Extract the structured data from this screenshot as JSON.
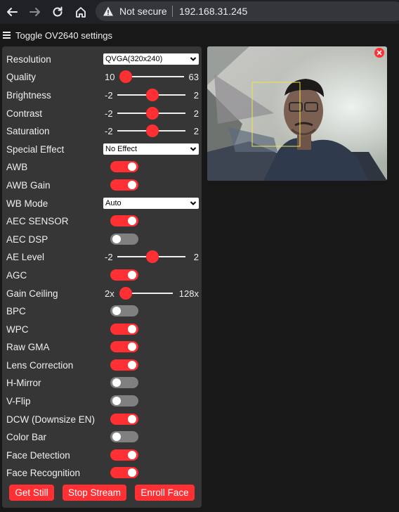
{
  "browser": {
    "security_text": "Not secure",
    "url": "192.168.31.245",
    "icons": [
      "back-arrow-icon",
      "forward-arrow-icon",
      "reload-icon",
      "home-icon",
      "warning-icon"
    ]
  },
  "header": {
    "toggle_label": "Toggle OV2640 settings",
    "icon": "hamburger-icon"
  },
  "colors": {
    "accent": "#ff3034",
    "panel_bg": "#363636",
    "page_bg": "#181818",
    "toggle_off": "#808080",
    "face_box": "#f0e54a"
  },
  "settings": {
    "resolution": {
      "label": "Resolution",
      "value": "QVGA(320x240)"
    },
    "quality": {
      "label": "Quality",
      "min": "10",
      "max": "63",
      "value": 10
    },
    "brightness": {
      "label": "Brightness",
      "min": "-2",
      "max": "2",
      "value": 0
    },
    "contrast": {
      "label": "Contrast",
      "min": "-2",
      "max": "2",
      "value": 0
    },
    "saturation": {
      "label": "Saturation",
      "min": "-2",
      "max": "2",
      "value": 0
    },
    "special_effect": {
      "label": "Special Effect",
      "value": "No Effect"
    },
    "awb": {
      "label": "AWB",
      "on": true
    },
    "awb_gain": {
      "label": "AWB Gain",
      "on": true
    },
    "wb_mode": {
      "label": "WB Mode",
      "value": "Auto"
    },
    "aec_sensor": {
      "label": "AEC SENSOR",
      "on": true
    },
    "aec_dsp": {
      "label": "AEC DSP",
      "on": false
    },
    "ae_level": {
      "label": "AE Level",
      "min": "-2",
      "max": "2",
      "value": 0
    },
    "agc": {
      "label": "AGC",
      "on": true
    },
    "gain_ceiling": {
      "label": "Gain Ceiling",
      "min": "2x",
      "max": "128x",
      "value": 0
    },
    "bpc": {
      "label": "BPC",
      "on": false
    },
    "wpc": {
      "label": "WPC",
      "on": true
    },
    "raw_gma": {
      "label": "Raw GMA",
      "on": true
    },
    "lens_correction": {
      "label": "Lens Correction",
      "on": true
    },
    "h_mirror": {
      "label": "H-Mirror",
      "on": false
    },
    "v_flip": {
      "label": "V-Flip",
      "on": false
    },
    "dcw": {
      "label": "DCW (Downsize EN)",
      "on": true
    },
    "color_bar": {
      "label": "Color Bar",
      "on": false
    },
    "face_detection": {
      "label": "Face Detection",
      "on": true
    },
    "face_recognition": {
      "label": "Face Recognition",
      "on": true
    }
  },
  "buttons": {
    "get_still": "Get Still",
    "stop_stream": "Stop Stream",
    "enroll_face": "Enroll Face"
  },
  "stream": {
    "close_icon": "close-icon"
  }
}
